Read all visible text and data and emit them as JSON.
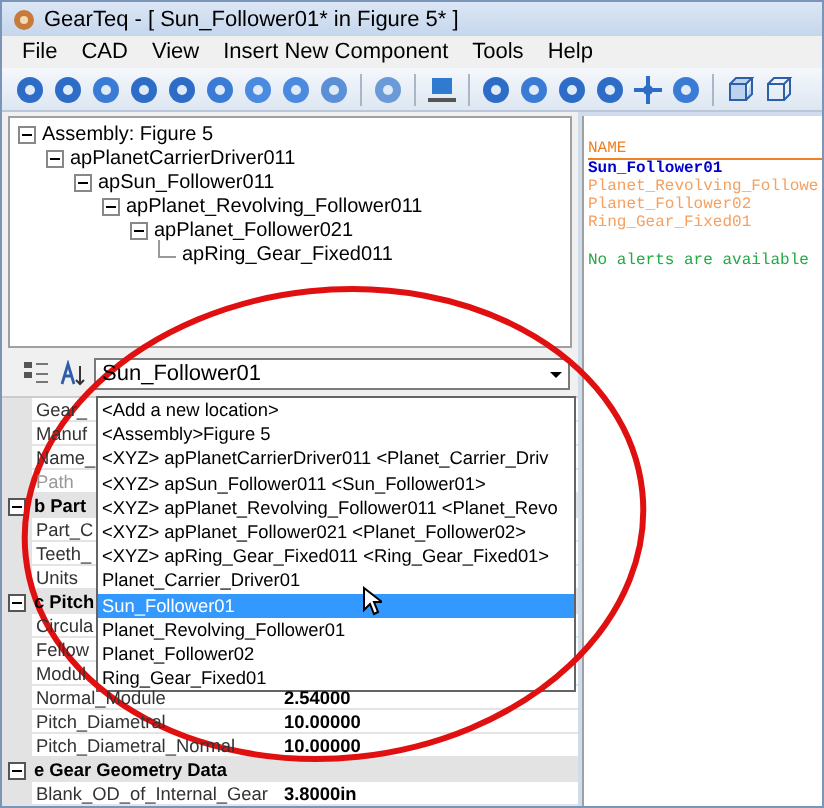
{
  "window": {
    "title": "GearTeq - [ Sun_Follower01*  in  Figure 5* ]"
  },
  "menu": [
    "File",
    "CAD",
    "View",
    "Insert New Component",
    "Tools",
    "Help"
  ],
  "tree": [
    {
      "label": "Assembly: Figure 5",
      "expanded": true,
      "children": [
        {
          "label": "apPlanetCarrierDriver011",
          "expanded": true,
          "children": [
            {
              "label": "apSun_Follower011",
              "expanded": true,
              "children": [
                {
                  "label": "apPlanet_Revolving_Follower011",
                  "expanded": true,
                  "children": [
                    {
                      "label": "apPlanet_Follower021",
                      "expanded": true,
                      "children": [
                        {
                          "label": "apRing_Gear_Fixed011"
                        }
                      ]
                    }
                  ]
                }
              ]
            }
          ]
        }
      ]
    }
  ],
  "properties": {
    "combo": {
      "value": "Sun_Follower01"
    },
    "dropdown": [
      {
        "label": "<Add a new location>",
        "selected": false
      },
      {
        "label": "<Assembly>Figure 5",
        "selected": false
      },
      {
        "label": "<XYZ> apPlanetCarrierDriver011 <Planet_Carrier_Driv",
        "selected": false
      },
      {
        "label": "<XYZ> apSun_Follower011 <Sun_Follower01>",
        "selected": false
      },
      {
        "label": "<XYZ> apPlanet_Revolving_Follower011 <Planet_Revo",
        "selected": false
      },
      {
        "label": "<XYZ> apPlanet_Follower021 <Planet_Follower02>",
        "selected": false
      },
      {
        "label": "<XYZ> apRing_Gear_Fixed011 <Ring_Gear_Fixed01>",
        "selected": false
      },
      {
        "label": "Planet_Carrier_Driver01",
        "selected": false
      },
      {
        "label": "Sun_Follower01",
        "selected": true
      },
      {
        "label": "Planet_Revolving_Follower01",
        "selected": false
      },
      {
        "label": "Planet_Follower02",
        "selected": false
      },
      {
        "label": "Ring_Gear_Fixed01",
        "selected": false
      }
    ],
    "rows": [
      {
        "kind": "row",
        "label": "Gear_",
        "disabled": false
      },
      {
        "kind": "row",
        "label": "Manuf",
        "disabled": false
      },
      {
        "kind": "row",
        "label": "Name_",
        "disabled": false
      },
      {
        "kind": "row",
        "label": "Path",
        "disabled": true
      },
      {
        "kind": "category",
        "label": "b Part",
        "expanded": true
      },
      {
        "kind": "row",
        "label": "Part_C",
        "disabled": false
      },
      {
        "kind": "row",
        "label": "Teeth_",
        "disabled": false
      },
      {
        "kind": "row",
        "label": "Units",
        "disabled": false
      },
      {
        "kind": "category",
        "label": "c Pitch",
        "expanded": true
      },
      {
        "kind": "row",
        "label": "Circula",
        "disabled": false
      },
      {
        "kind": "row",
        "label": "Fellow",
        "disabled": false
      },
      {
        "kind": "row",
        "label": "Modul",
        "disabled": false
      },
      {
        "kind": "row",
        "label": "Normal_Module",
        "value": "2.54000",
        "disabled": false
      },
      {
        "kind": "row",
        "label": "Pitch_Diametral",
        "value": "10.00000",
        "disabled": false
      },
      {
        "kind": "row",
        "label": "Pitch_Diametral_Normal",
        "value": "10.00000",
        "disabled": false
      },
      {
        "kind": "category",
        "label": "e Gear Geometry Data",
        "expanded": true
      },
      {
        "kind": "row",
        "label": "Blank_OD_of_Internal_Gear",
        "value": "3.8000in",
        "disabled": false
      }
    ]
  },
  "panel": {
    "header": "NAME",
    "items": [
      {
        "label": "Sun_Follower01",
        "selected": true
      },
      {
        "label": "Planet_Revolving_Followe",
        "selected": false
      },
      {
        "label": "Planet_Follower02",
        "selected": false
      },
      {
        "label": "Ring_Gear_Fixed01",
        "selected": false
      }
    ],
    "message": "No alerts are available"
  }
}
